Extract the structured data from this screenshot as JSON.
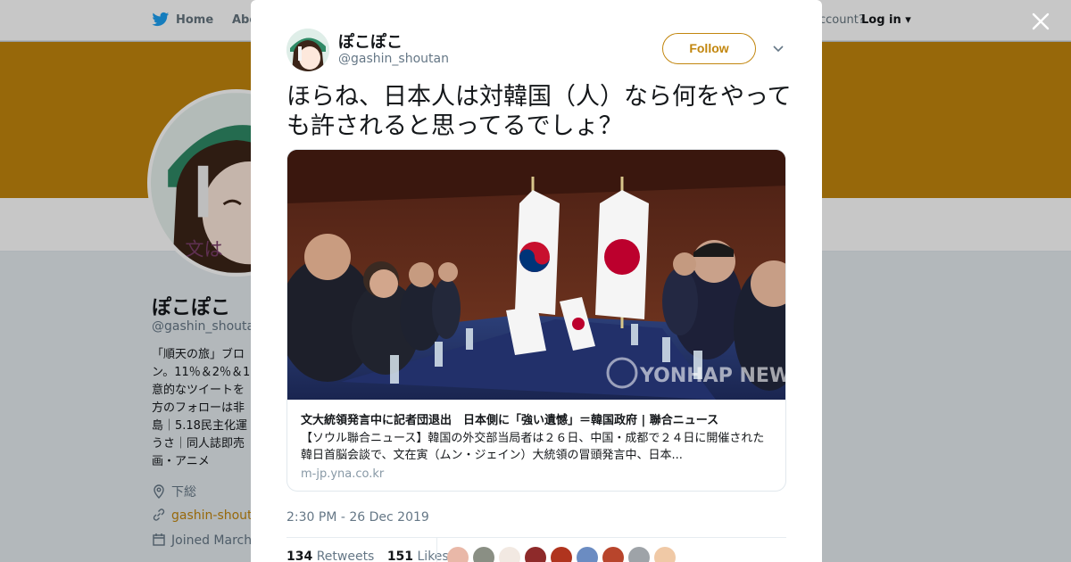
{
  "nav": {
    "home_label": "Home",
    "about_label": "Abo",
    "account_prompt": "ccount?",
    "login_label": "Log in"
  },
  "profile": {
    "name": "ぽこぽこ",
    "handle": "@gashin_shoutan",
    "bio_lines": [
      "「順天の旅」ブロ",
      "ン。11％＆2％＆1",
      "意的なツイートを",
      "方のフォローは非",
      "島｜5.18民主化運",
      "うさ｜同人誌即売",
      "画・アニメ"
    ],
    "location": "下総",
    "website": "gashin-shouta",
    "joined": "Joined March"
  },
  "tweet": {
    "author_name": "ぽこぽこ",
    "author_handle": "@gashin_shoutan",
    "follow_label": "Follow",
    "text": "ほらね、日本人は対韓国（人）なら何をやっても許されると思ってるでしょ？",
    "card": {
      "title": "文大統領発言中に記者団退出　日本側に「強い遺憾」＝韓国政府 | 聯合ニュース",
      "description": "【ソウル聯合ニュース】韓国の外交部当局者は２６日、中国・成都で２４日に開催された韓日首脳会談で、文在寅（ムン・ジェイン）大統領の冒頭発言中、日本...",
      "domain": "m-jp.yna.co.kr",
      "watermark": "YONHAP NEWS"
    },
    "timestamp": "2:30 PM - 26 Dec 2019",
    "retweets_count": "134",
    "retweets_label": "Retweets",
    "likes_count": "151",
    "likes_label": "Likes"
  },
  "colors": {
    "accent": "#c2860e",
    "twitter_blue": "#1da1f2",
    "text": "#14171a",
    "muted": "#657786"
  },
  "icons": {
    "close": "close-icon",
    "caret": "chevron-down-icon",
    "bird": "twitter-bird-icon",
    "location": "location-pin-icon",
    "link": "link-icon",
    "calendar": "calendar-icon"
  }
}
